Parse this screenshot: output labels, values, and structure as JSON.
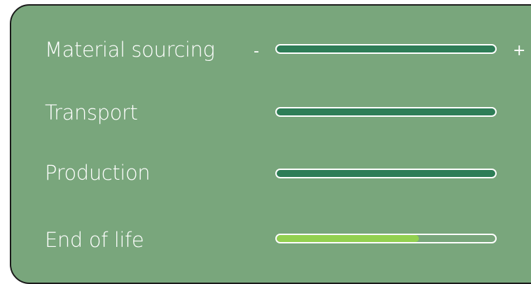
{
  "scale": {
    "minus_label": "-",
    "plus_label": "+"
  },
  "rows": [
    {
      "label": "Material sourcing",
      "value": 1.0,
      "fill_color": "#2e7d57"
    },
    {
      "label": "Transport",
      "value": 1.0,
      "fill_color": "#2e7d57"
    },
    {
      "label": "Production",
      "value": 1.0,
      "fill_color": "#2e7d57"
    },
    {
      "label": "End of life",
      "value": 0.65,
      "fill_color": "#92d050"
    }
  ],
  "colors": {
    "panel_background": "#79a67c",
    "bar_outline": "#ffffff",
    "text": "#ffffff"
  }
}
